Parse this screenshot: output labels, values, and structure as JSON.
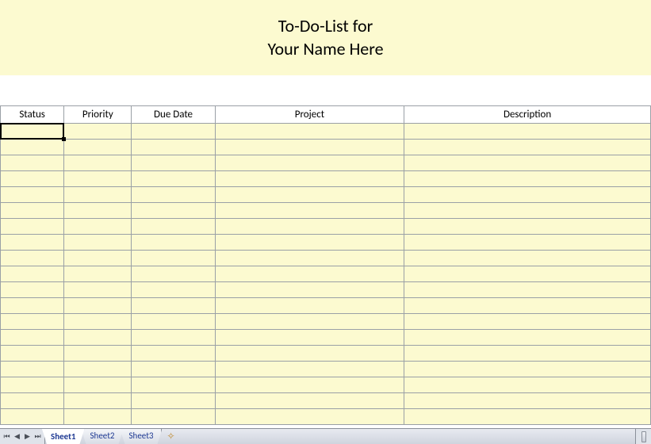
{
  "header": {
    "line1": "To-Do-List for",
    "line2": "Your Name Here"
  },
  "columns": {
    "status": "Status",
    "priority": "Priority",
    "duedate": "Due Date",
    "project": "Project",
    "description": "Description"
  },
  "rows": [
    {
      "status": "",
      "priority": "",
      "duedate": "",
      "project": "",
      "description": ""
    },
    {
      "status": "",
      "priority": "",
      "duedate": "",
      "project": "",
      "description": ""
    },
    {
      "status": "",
      "priority": "",
      "duedate": "",
      "project": "",
      "description": ""
    },
    {
      "status": "",
      "priority": "",
      "duedate": "",
      "project": "",
      "description": ""
    },
    {
      "status": "",
      "priority": "",
      "duedate": "",
      "project": "",
      "description": ""
    },
    {
      "status": "",
      "priority": "",
      "duedate": "",
      "project": "",
      "description": ""
    },
    {
      "status": "",
      "priority": "",
      "duedate": "",
      "project": "",
      "description": ""
    },
    {
      "status": "",
      "priority": "",
      "duedate": "",
      "project": "",
      "description": ""
    },
    {
      "status": "",
      "priority": "",
      "duedate": "",
      "project": "",
      "description": ""
    },
    {
      "status": "",
      "priority": "",
      "duedate": "",
      "project": "",
      "description": ""
    },
    {
      "status": "",
      "priority": "",
      "duedate": "",
      "project": "",
      "description": ""
    },
    {
      "status": "",
      "priority": "",
      "duedate": "",
      "project": "",
      "description": ""
    },
    {
      "status": "",
      "priority": "",
      "duedate": "",
      "project": "",
      "description": ""
    },
    {
      "status": "",
      "priority": "",
      "duedate": "",
      "project": "",
      "description": ""
    },
    {
      "status": "",
      "priority": "",
      "duedate": "",
      "project": "",
      "description": ""
    },
    {
      "status": "",
      "priority": "",
      "duedate": "",
      "project": "",
      "description": ""
    },
    {
      "status": "",
      "priority": "",
      "duedate": "",
      "project": "",
      "description": ""
    },
    {
      "status": "",
      "priority": "",
      "duedate": "",
      "project": "",
      "description": ""
    },
    {
      "status": "",
      "priority": "",
      "duedate": "",
      "project": "",
      "description": ""
    }
  ],
  "tabs": {
    "sheet1": "Sheet1",
    "sheet2": "Sheet2",
    "sheet3": "Sheet3"
  }
}
